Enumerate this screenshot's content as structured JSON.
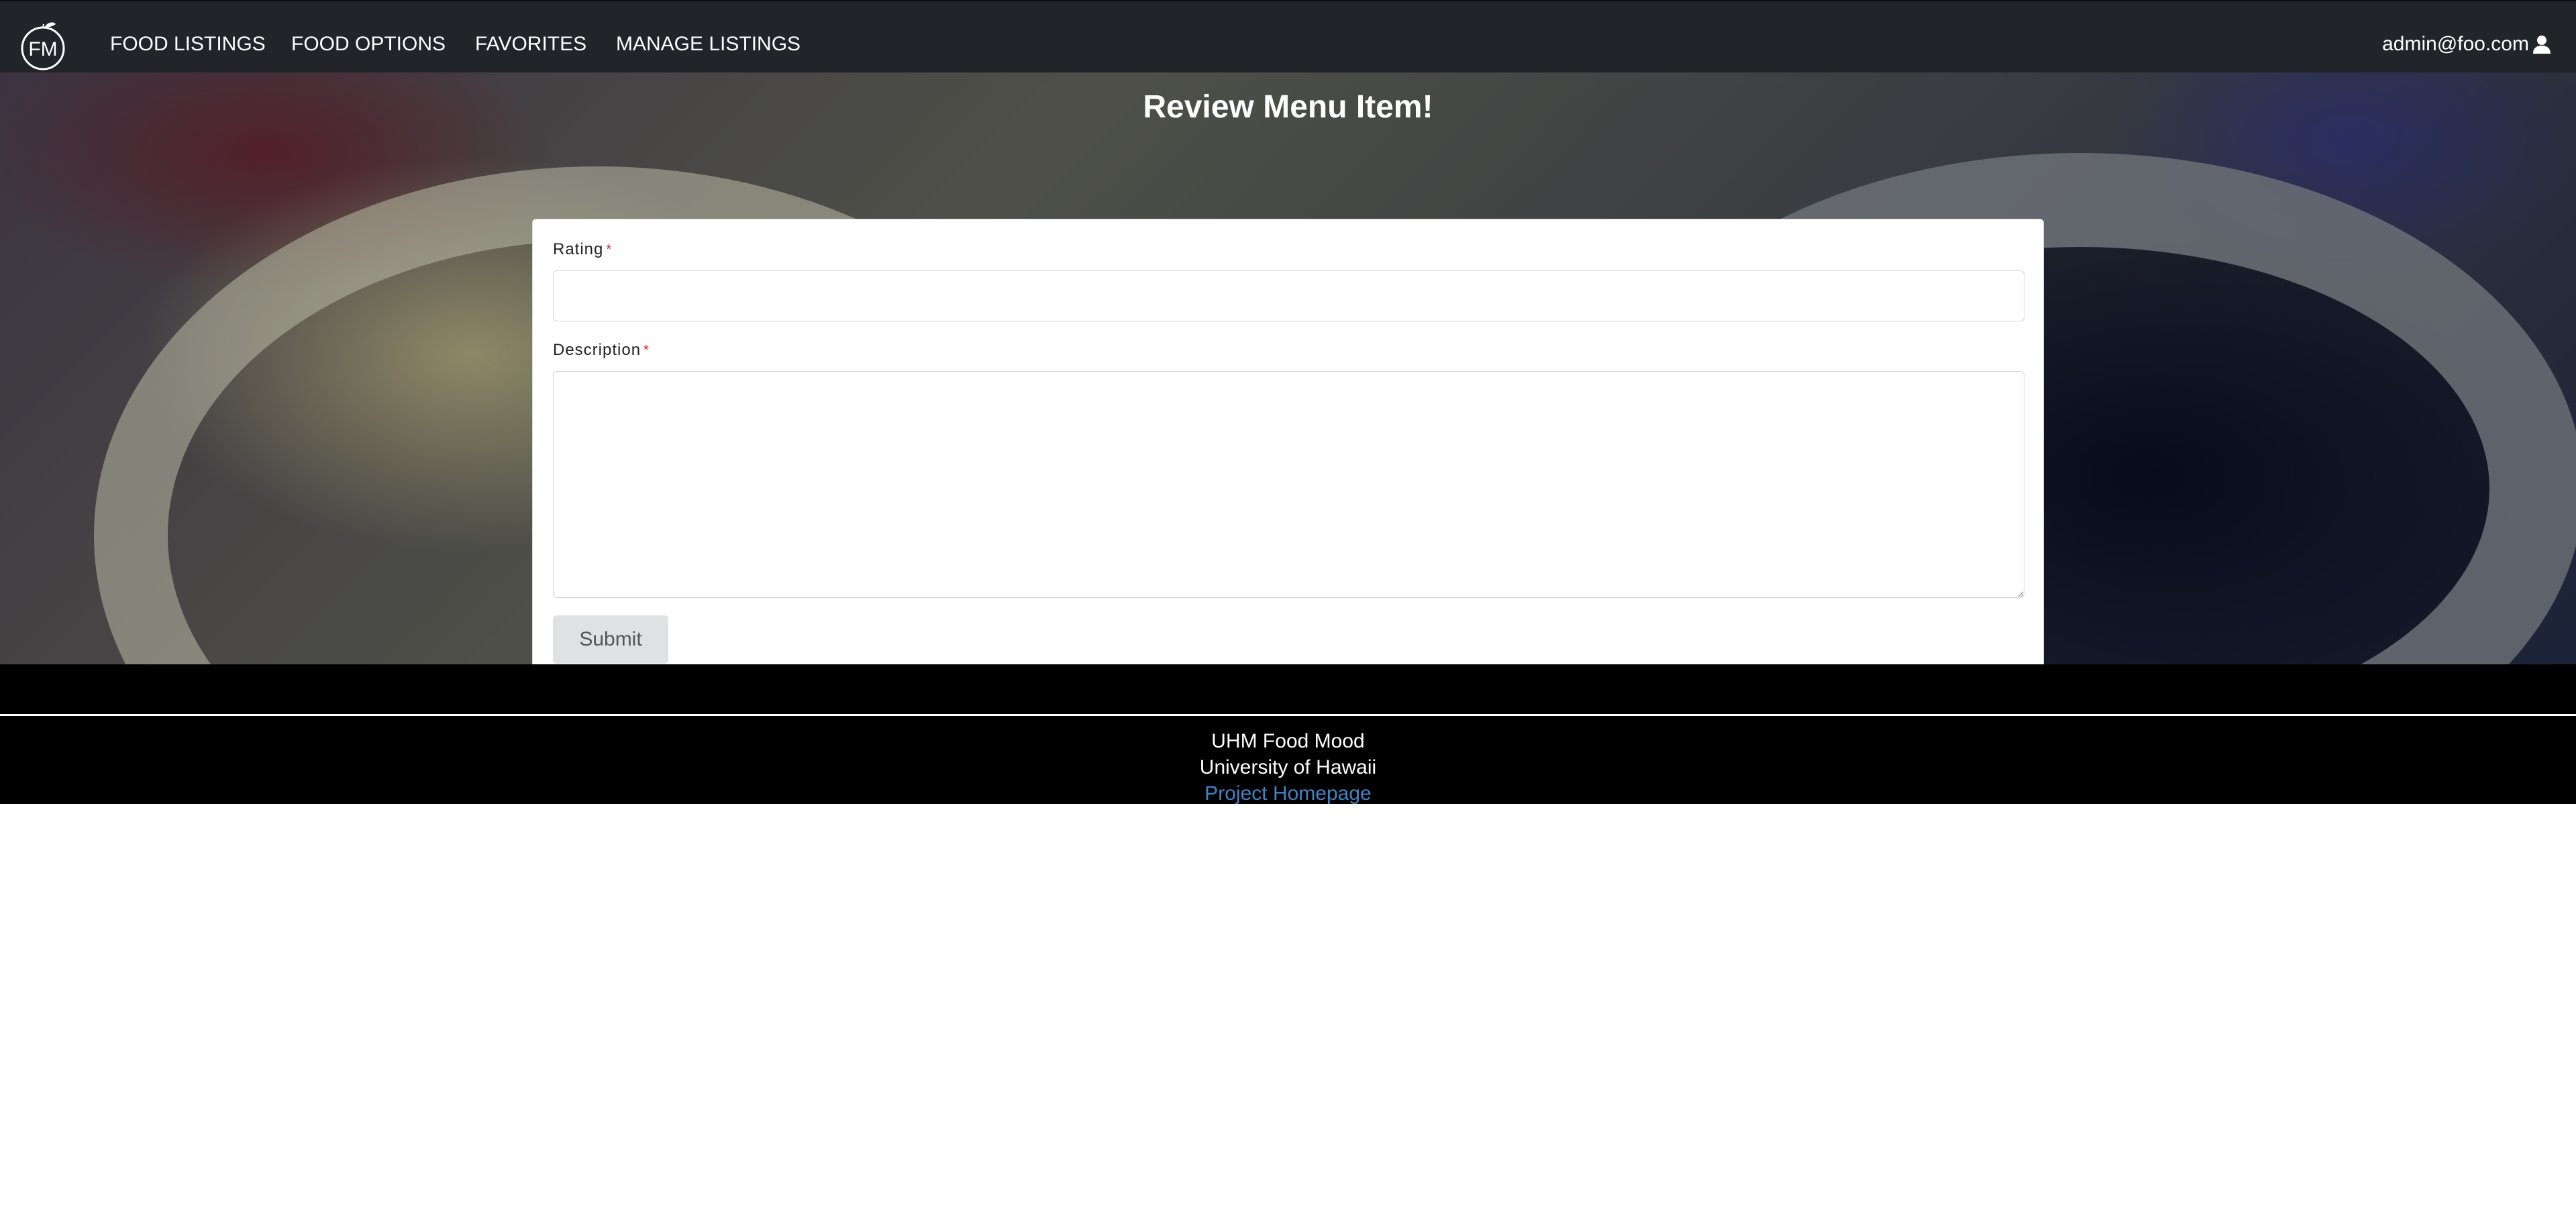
{
  "navbar": {
    "logo_text": "FM",
    "items": [
      {
        "label": "FOOD LISTINGS"
      },
      {
        "label": "FOOD OPTIONS"
      },
      {
        "label": "FAVORITES"
      },
      {
        "label": "MANAGE LISTINGS"
      }
    ],
    "user": {
      "label": "admin@foo.com",
      "icon": "user-icon"
    }
  },
  "page": {
    "title": "Review Menu Item!"
  },
  "form": {
    "rating": {
      "label": "Rating",
      "required_marker": "*",
      "value": "",
      "placeholder": ""
    },
    "description": {
      "label": "Description",
      "required_marker": "*",
      "value": "",
      "placeholder": ""
    },
    "submit_label": "Submit"
  },
  "footer": {
    "line1": "UHM Food Mood",
    "line2": "University of Hawaii",
    "link_label": "Project Homepage",
    "link_color": "#4183c4"
  },
  "colors": {
    "navbar_bg": "#212529",
    "footer_bg": "#000000",
    "required": "#db2828",
    "button_bg": "#e0e1e2"
  }
}
